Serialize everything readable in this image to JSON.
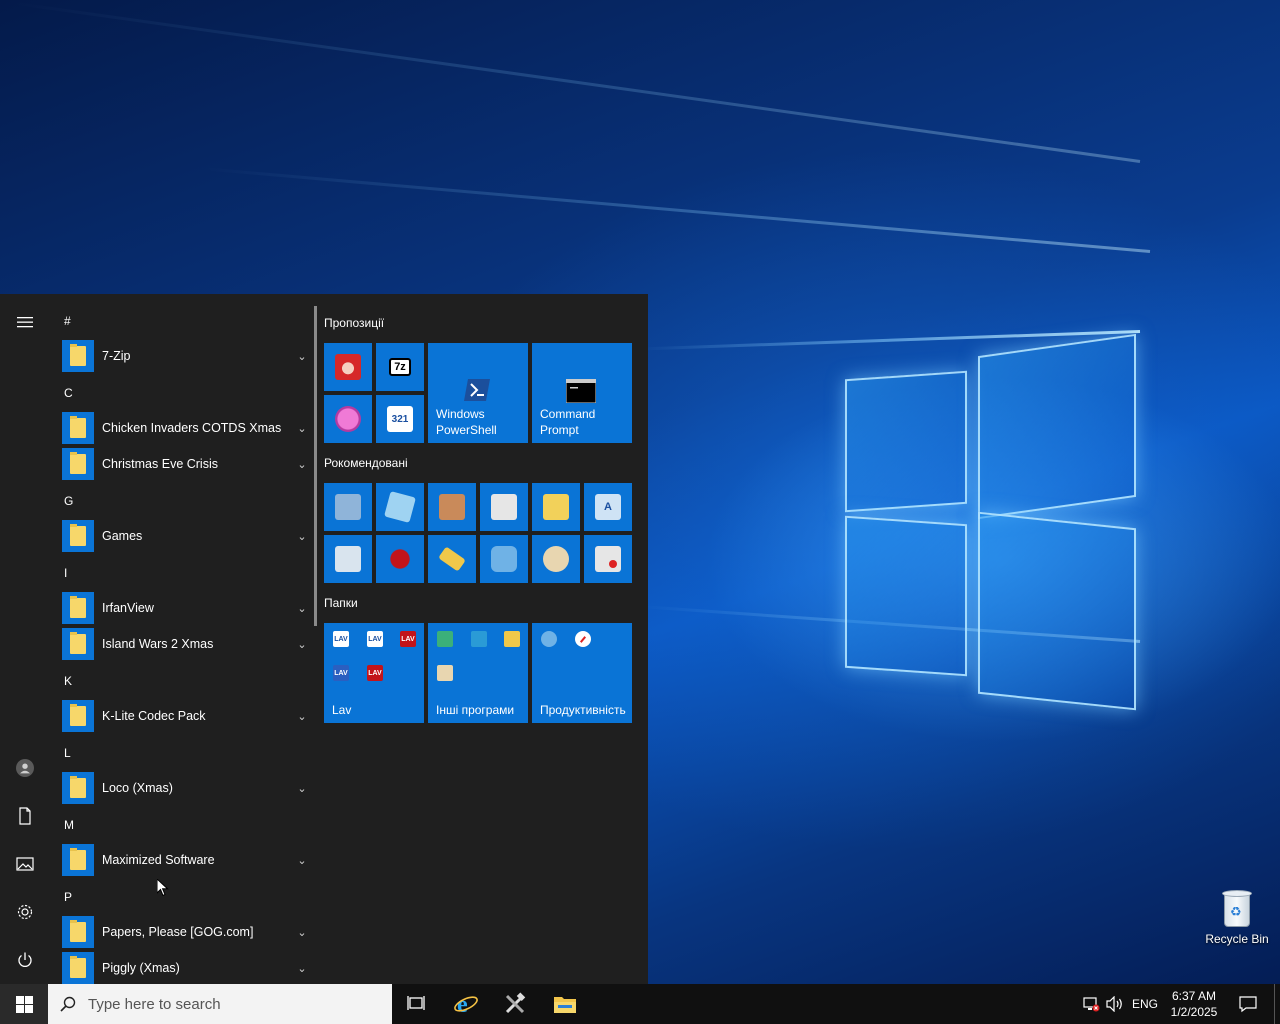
{
  "desktop": {
    "recycle_bin_label": "Recycle Bin"
  },
  "start_menu": {
    "app_list": [
      {
        "type": "header",
        "label": "#"
      },
      {
        "type": "app",
        "label": "7-Zip"
      },
      {
        "type": "header",
        "label": "C"
      },
      {
        "type": "app",
        "label": "Chicken Invaders COTDS Xmas"
      },
      {
        "type": "app",
        "label": "Christmas Eve Crisis"
      },
      {
        "type": "header",
        "label": "G"
      },
      {
        "type": "app",
        "label": "Games"
      },
      {
        "type": "header",
        "label": "I"
      },
      {
        "type": "app",
        "label": "IrfanView"
      },
      {
        "type": "app",
        "label": "Island Wars 2 Xmas"
      },
      {
        "type": "header",
        "label": "K"
      },
      {
        "type": "app",
        "label": "K-Lite Codec Pack"
      },
      {
        "type": "header",
        "label": "L"
      },
      {
        "type": "app",
        "label": "Loco (Xmas)"
      },
      {
        "type": "header",
        "label": "M"
      },
      {
        "type": "app",
        "label": "Maximized Software"
      },
      {
        "type": "header",
        "label": "P"
      },
      {
        "type": "app",
        "label": "Papers, Please [GOG.com]"
      },
      {
        "type": "app",
        "label": "Piggly (Xmas)"
      }
    ],
    "tile_groups": [
      {
        "title": "Пропозиції"
      },
      {
        "title": "Рокомендовані"
      },
      {
        "title": "Папки"
      }
    ],
    "tiles": {
      "powershell_line1": "Windows",
      "powershell_line2": "PowerShell",
      "cmd_line1": "Command",
      "cmd_line2": "Prompt",
      "sevenzip_glyph": "7z",
      "lav_folder": "Lav",
      "other_programs_folder": "Інші програми",
      "productivity_folder": "Продуктивність"
    }
  },
  "taskbar": {
    "search_placeholder": "Type here to search",
    "language": "ENG",
    "time": "6:37 AM",
    "date": "1/2/2025"
  },
  "colors": {
    "accent": "#0a74d6",
    "menu_bg": "#1f1f1f",
    "taskbar_bg": "#101010"
  }
}
